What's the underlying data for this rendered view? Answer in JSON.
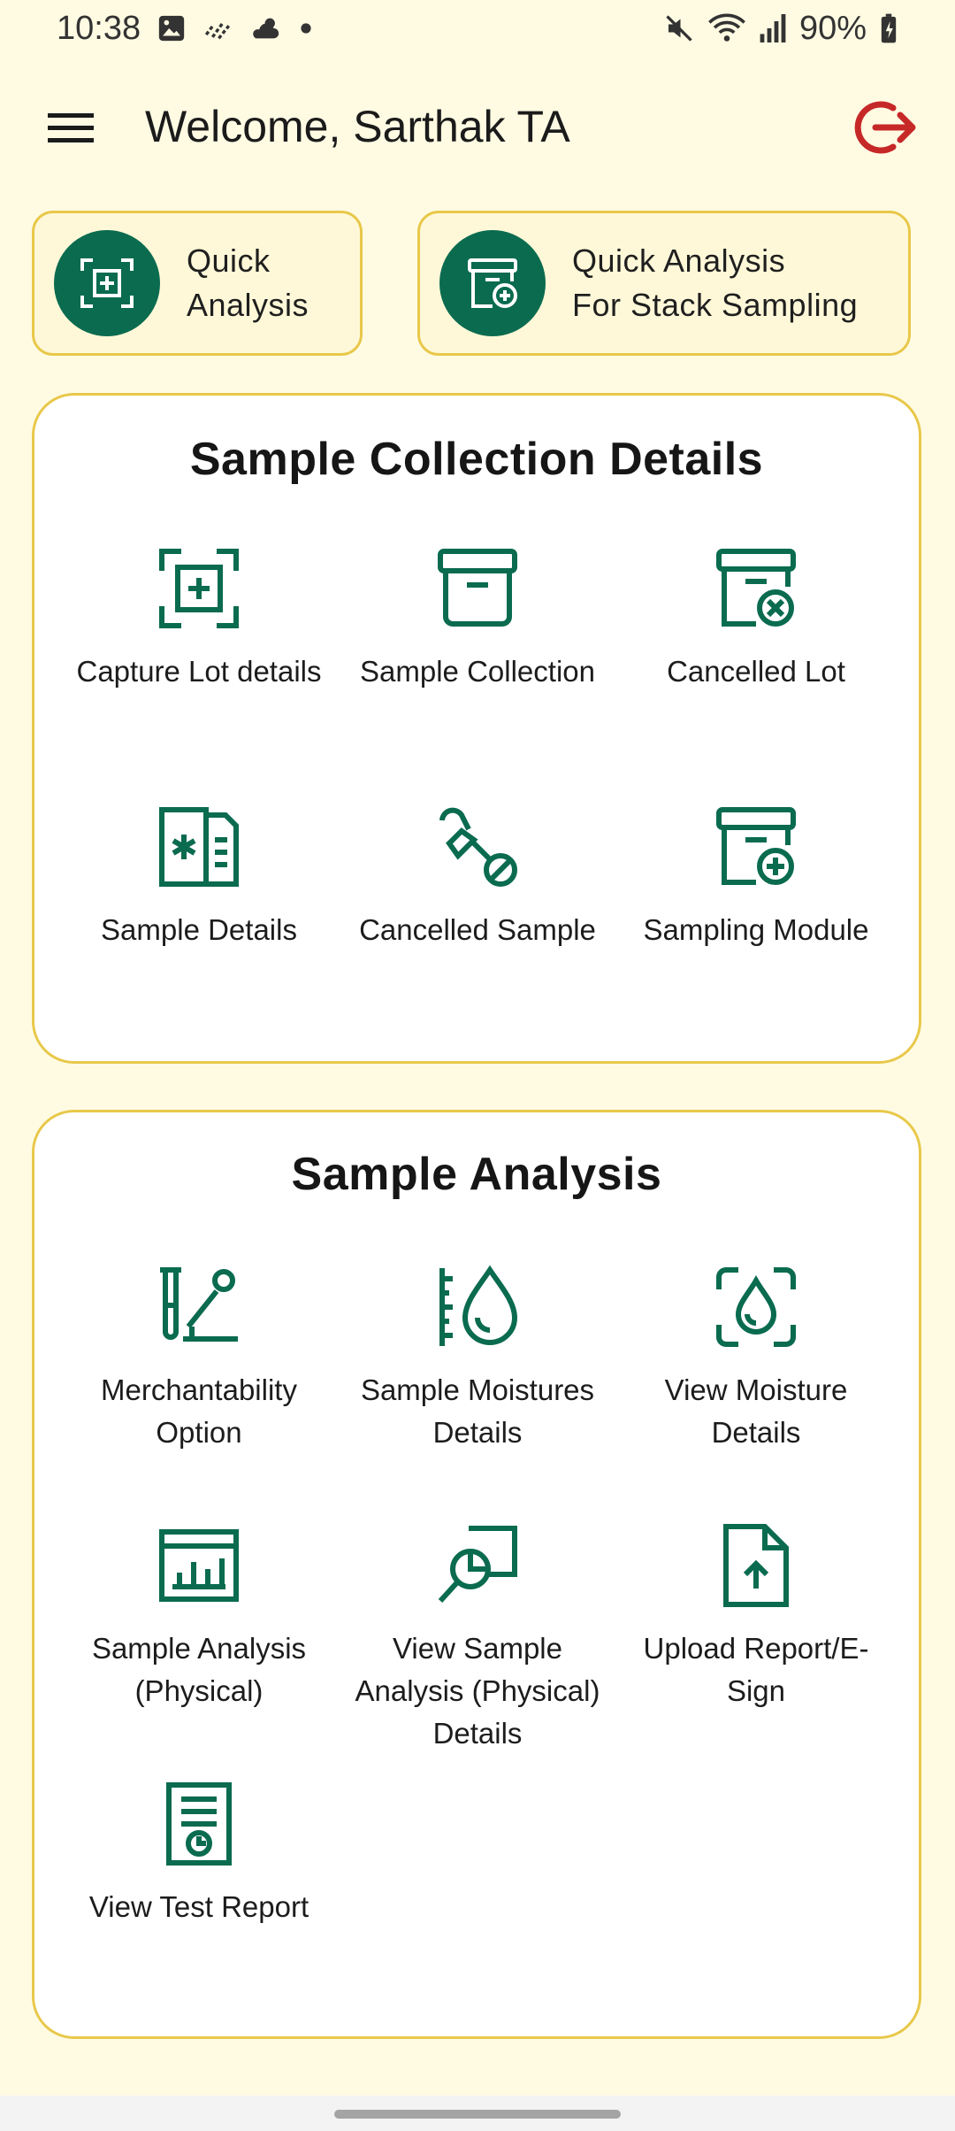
{
  "status_bar": {
    "time": "10:38",
    "battery": "90%",
    "icons": [
      "image-icon",
      "signal-dashes-icon",
      "weather-icon",
      "dot-icon",
      "mute-icon",
      "wifi-icon",
      "cell-signal-icon",
      "battery-charging-icon"
    ]
  },
  "header": {
    "title": "Welcome, Sarthak TA",
    "menu_icon": "hamburger-menu-icon",
    "logout_icon": "logout-icon",
    "logout_color": "#c62828"
  },
  "quick_actions": [
    {
      "line1": "Quick",
      "line2": "Analysis",
      "icon": "scan-add-icon"
    },
    {
      "line1": "Quick Analysis",
      "line2": "For Stack Sampling",
      "icon": "archive-add-icon"
    }
  ],
  "sample_collection": {
    "title": "Sample Collection Details",
    "tiles": [
      {
        "label": "Capture Lot details",
        "icon": "scan-add-icon"
      },
      {
        "label": "Sample Collection",
        "icon": "archive-box-icon"
      },
      {
        "label": "Cancelled Lot",
        "icon": "archive-cancel-icon"
      },
      {
        "label": "Sample Details",
        "icon": "document-details-icon"
      },
      {
        "label": "Cancelled Sample",
        "icon": "dropper-cancel-icon"
      },
      {
        "label": "Sampling Module",
        "icon": "archive-add-icon"
      }
    ]
  },
  "sample_analysis": {
    "title": "Sample Analysis",
    "tiles": [
      {
        "line1": "Merchantability",
        "line2": "Option",
        "icon": "test-tube-icon"
      },
      {
        "line1": "Sample Moistures",
        "line2": "Details",
        "icon": "moisture-ruler-icon"
      },
      {
        "line1": "View Moisture",
        "line2": "Details",
        "icon": "scan-moisture-icon"
      },
      {
        "line1": "Sample Analysis",
        "line2": "(Physical)",
        "icon": "bar-chart-icon"
      },
      {
        "line1": "View Sample",
        "line2": "Analysis (Physical)",
        "line3": "Details",
        "icon": "search-chart-icon"
      },
      {
        "line1": "Upload Report/E-",
        "line2": "Sign",
        "icon": "file-upload-icon"
      },
      {
        "line1": "View Test Report",
        "icon": "report-icon"
      }
    ]
  },
  "colors": {
    "background": "#fffbe3",
    "accent_green": "#0a6b4f",
    "border_yellow": "#e8c84a"
  }
}
